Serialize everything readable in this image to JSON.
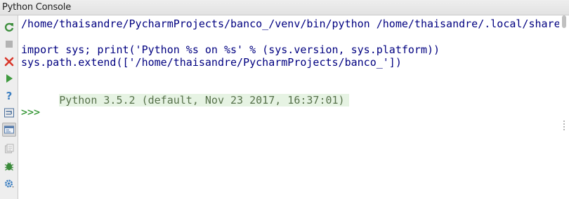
{
  "window": {
    "title": "Python Console"
  },
  "toolbar": {
    "buttons": [
      {
        "icon": "rerun-icon",
        "color": "#3f8f3f"
      },
      {
        "icon": "stop-icon",
        "color": "#b3b3b3"
      },
      {
        "icon": "close-icon",
        "color": "#d9372b"
      },
      {
        "icon": "execute-icon",
        "color": "#3f9a3f"
      },
      {
        "icon": "help-icon",
        "color": "#3d7fc1"
      },
      {
        "icon": "soft-wrap-icon",
        "color": "#4a6f9c"
      },
      {
        "icon": "show-variables-icon",
        "color": "#5a7fae"
      },
      {
        "icon": "history-icon",
        "color": "#b3b3b3"
      },
      {
        "icon": "debug-icon",
        "color": "#3a8a3a"
      },
      {
        "icon": "settings-icon",
        "color": "#3d7fc1"
      }
    ]
  },
  "console": {
    "command_line": "/home/thaisandre/PycharmProjects/banco_/venv/bin/python /home/thaisandre/.local/share/",
    "import_line": "import sys; print('Python %s on %s' % (sys.version, sys.platform))",
    "path_line": "sys.path.extend(['/home/thaisandre/PycharmProjects/banco_'])",
    "banner": "Python 3.5.2 (default, Nov 23 2017, 16:37:01)",
    "prompt": ">>>"
  },
  "colors": {
    "command_text": "#000080",
    "banner_text": "#57714b",
    "banner_background": "#e6f3e3",
    "prompt_text": "#1b8a1b"
  }
}
